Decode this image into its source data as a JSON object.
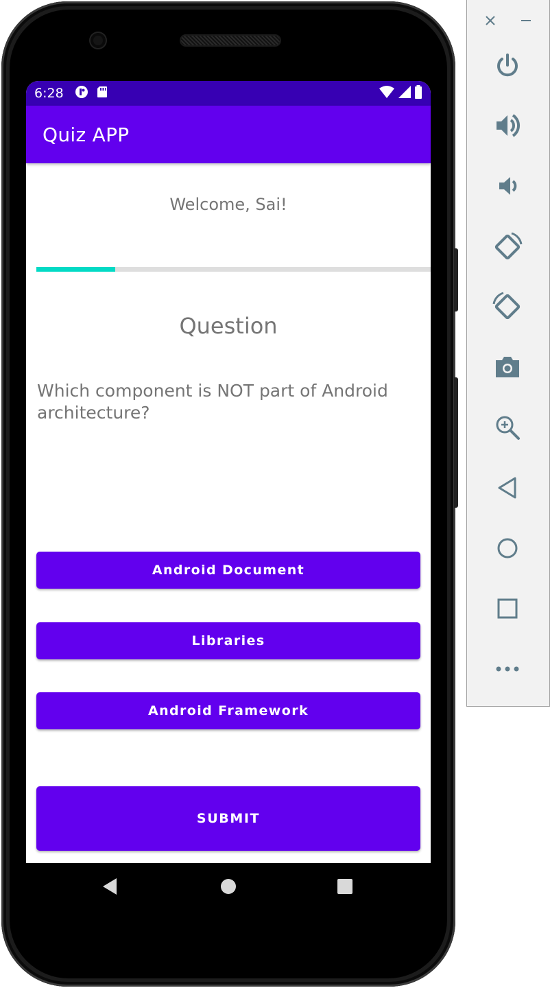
{
  "status_bar": {
    "time": "6:28",
    "left_icons": [
      "app-notification-icon",
      "sd-card-icon"
    ],
    "right_icons": [
      "wifi-icon",
      "cellular-signal-icon",
      "battery-icon"
    ]
  },
  "app_bar": {
    "title": "Quiz APP"
  },
  "welcome_text": "Welcome, Sai!",
  "progress": {
    "value": 0.2
  },
  "question": {
    "heading": "Question",
    "text": "Which component is NOT part of Android architecture?"
  },
  "options": [
    {
      "label": "Android Document"
    },
    {
      "label": "Libraries"
    },
    {
      "label": "Android Framework"
    }
  ],
  "submit_label": "SUBMIT",
  "nav_bar": {
    "icons": [
      "back-icon",
      "home-icon",
      "recents-icon"
    ]
  },
  "emulator_toolbar": {
    "icons": [
      "close-icon",
      "minimize-icon",
      "power-icon",
      "volume-up-icon",
      "volume-down-icon",
      "rotate-left-icon",
      "rotate-right-icon",
      "camera-icon",
      "zoom-icon",
      "back-icon",
      "home-icon",
      "overview-icon",
      "more-icon"
    ]
  },
  "colors": {
    "status_bar": "#3700b3",
    "primary": "#6200ee",
    "progress": "#03dac5",
    "text_gray": "#757575",
    "toolbar_icon": "#607d8b"
  }
}
